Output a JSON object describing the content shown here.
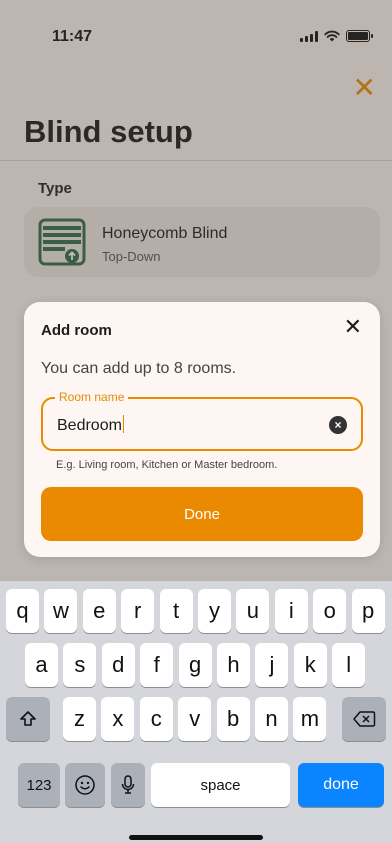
{
  "status_bar": {
    "time": "11:47"
  },
  "header": {
    "title": "Blind setup"
  },
  "type_section": {
    "label": "Type",
    "card": {
      "name": "Honeycomb Blind",
      "subtitle": "Top-Down",
      "icon": "honeycomb-blind-icon"
    }
  },
  "dialog": {
    "title": "Add room",
    "description": "You can add up to 8 rooms.",
    "field": {
      "label": "Room name",
      "value": "Bedroom"
    },
    "hint": "E.g. Living room, Kitchen or Master bedroom.",
    "done_label": "Done"
  },
  "keyboard": {
    "row1": [
      "q",
      "w",
      "e",
      "r",
      "t",
      "y",
      "u",
      "i",
      "o",
      "p"
    ],
    "row2": [
      "a",
      "s",
      "d",
      "f",
      "g",
      "h",
      "j",
      "k",
      "l"
    ],
    "row3": [
      "z",
      "x",
      "c",
      "v",
      "b",
      "n",
      "m"
    ],
    "numbers_label": "123",
    "space_label": "space",
    "done_label": "done"
  },
  "colors": {
    "accent": "#e98a00",
    "icon_green": "#2e6b4a",
    "keyboard_action": "#0a84ff"
  }
}
